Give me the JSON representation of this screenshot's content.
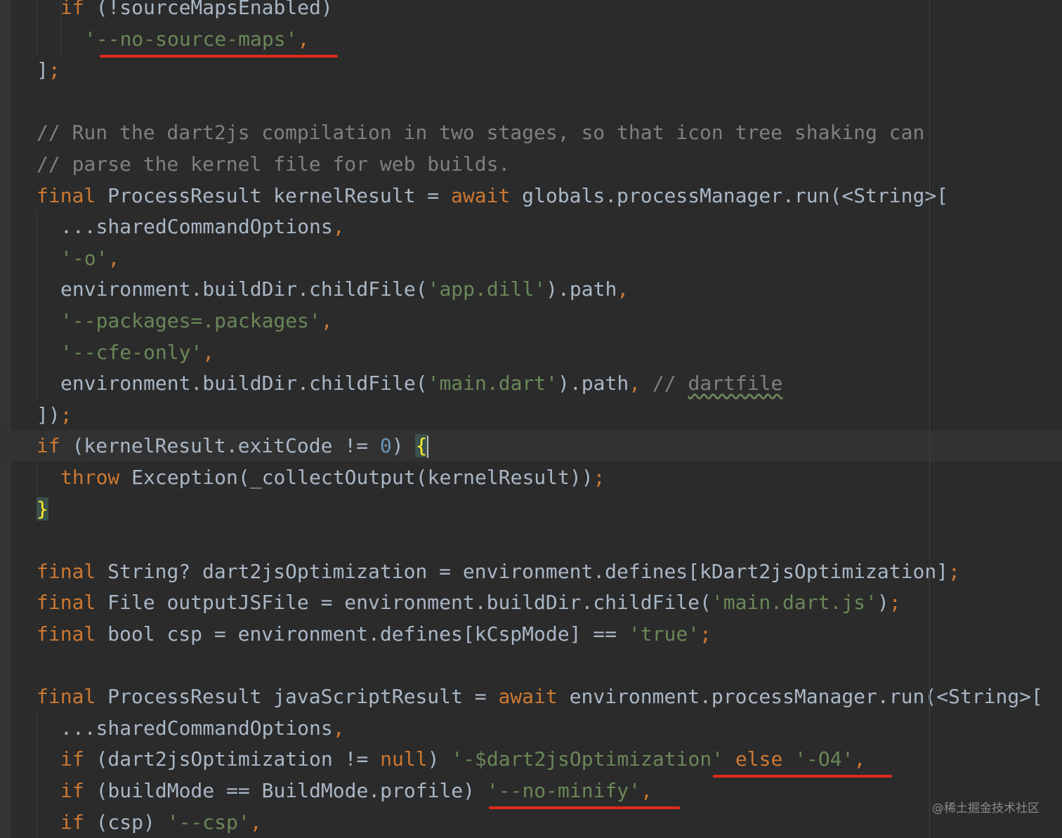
{
  "editor": {
    "lines": [
      {
        "indent": 1,
        "tokens": [
          {
            "c": "k",
            "t": "if"
          },
          {
            "c": "t",
            "t": " (!sourceMapsEnabled)"
          }
        ]
      },
      {
        "indent": 2,
        "tokens": [
          {
            "c": "s",
            "t": "'--no-source-maps'"
          },
          {
            "c": "p",
            "t": ","
          }
        ]
      },
      {
        "indent": 0,
        "tokens": [
          {
            "c": "t",
            "t": "]"
          },
          {
            "c": "p",
            "t": ";"
          }
        ]
      },
      {
        "indent": 0,
        "tokens": []
      },
      {
        "indent": 0,
        "tokens": [
          {
            "c": "c",
            "t": "// Run the dart2js compilation in two stages, so that icon tree shaking can"
          }
        ]
      },
      {
        "indent": 0,
        "tokens": [
          {
            "c": "c",
            "t": "// parse the kernel file for web builds."
          }
        ]
      },
      {
        "indent": 0,
        "tokens": [
          {
            "c": "k",
            "t": "final"
          },
          {
            "c": "t",
            "t": " ProcessResult kernelResult = "
          },
          {
            "c": "k",
            "t": "await"
          },
          {
            "c": "t",
            "t": " globals.processManager.run(<String>["
          }
        ]
      },
      {
        "indent": 1,
        "tokens": [
          {
            "c": "t",
            "t": "...sharedCommandOptions"
          },
          {
            "c": "p",
            "t": ","
          }
        ]
      },
      {
        "indent": 1,
        "tokens": [
          {
            "c": "s",
            "t": "'-o'"
          },
          {
            "c": "p",
            "t": ","
          }
        ]
      },
      {
        "indent": 1,
        "tokens": [
          {
            "c": "t",
            "t": "environment.buildDir.childFile("
          },
          {
            "c": "s",
            "t": "'app.dill'"
          },
          {
            "c": "t",
            "t": ").path"
          },
          {
            "c": "p",
            "t": ","
          }
        ]
      },
      {
        "indent": 1,
        "tokens": [
          {
            "c": "s",
            "t": "'--packages=.packages'"
          },
          {
            "c": "p",
            "t": ","
          }
        ]
      },
      {
        "indent": 1,
        "tokens": [
          {
            "c": "s",
            "t": "'--cfe-only'"
          },
          {
            "c": "p",
            "t": ","
          }
        ]
      },
      {
        "indent": 1,
        "tokens": [
          {
            "c": "t",
            "t": "environment.buildDir.childFile("
          },
          {
            "c": "s",
            "t": "'main.dart'"
          },
          {
            "c": "t",
            "t": ").path"
          },
          {
            "c": "p",
            "t": ","
          },
          {
            "c": "c",
            "t": " // "
          },
          {
            "c": "c warn",
            "t": "dartfile"
          }
        ]
      },
      {
        "indent": 0,
        "tokens": [
          {
            "c": "t",
            "t": "])"
          },
          {
            "c": "p",
            "t": ";"
          }
        ]
      },
      {
        "indent": 0,
        "current": true,
        "tokens": [
          {
            "c": "k",
            "t": "if"
          },
          {
            "c": "t",
            "t": " (kernelResult.exitCode != "
          },
          {
            "c": "n",
            "t": "0"
          },
          {
            "c": "t",
            "t": ") "
          },
          {
            "c": "brace-hl",
            "t": "{"
          },
          {
            "c": "caret",
            "t": ""
          }
        ]
      },
      {
        "indent": 1,
        "tokens": [
          {
            "c": "k",
            "t": "throw"
          },
          {
            "c": "t",
            "t": " Exception(_collectOutput(kernelResult))"
          },
          {
            "c": "p",
            "t": ";"
          }
        ]
      },
      {
        "indent": 0,
        "tokens": [
          {
            "c": "brace-hl",
            "t": "}"
          }
        ]
      },
      {
        "indent": 0,
        "tokens": []
      },
      {
        "indent": 0,
        "tokens": [
          {
            "c": "k",
            "t": "final"
          },
          {
            "c": "t",
            "t": " String? dart2jsOptimization = environment.defines[kDart2jsOptimization]"
          },
          {
            "c": "p",
            "t": ";"
          }
        ]
      },
      {
        "indent": 0,
        "tokens": [
          {
            "c": "k",
            "t": "final"
          },
          {
            "c": "t",
            "t": " File outputJSFile = environment.buildDir.childFile("
          },
          {
            "c": "s",
            "t": "'main.dart.js'"
          },
          {
            "c": "t",
            "t": ")"
          },
          {
            "c": "p",
            "t": ";"
          }
        ]
      },
      {
        "indent": 0,
        "tokens": [
          {
            "c": "k",
            "t": "final"
          },
          {
            "c": "t",
            "t": " bool csp = environment.defines[kCspMode] == "
          },
          {
            "c": "s",
            "t": "'true'"
          },
          {
            "c": "p",
            "t": ";"
          }
        ]
      },
      {
        "indent": 0,
        "tokens": []
      },
      {
        "indent": 0,
        "tokens": [
          {
            "c": "k",
            "t": "final"
          },
          {
            "c": "t",
            "t": " ProcessResult javaScriptResult = "
          },
          {
            "c": "k",
            "t": "await"
          },
          {
            "c": "t",
            "t": " environment.processManager.run(<String>["
          }
        ]
      },
      {
        "indent": 1,
        "tokens": [
          {
            "c": "t",
            "t": "...sharedCommandOptions"
          },
          {
            "c": "p",
            "t": ","
          }
        ]
      },
      {
        "indent": 1,
        "tokens": [
          {
            "c": "k",
            "t": "if"
          },
          {
            "c": "t",
            "t": " (dart2jsOptimization != "
          },
          {
            "c": "k",
            "t": "null"
          },
          {
            "c": "t",
            "t": ") "
          },
          {
            "c": "s",
            "t": "'-$dart2jsOptimization'"
          },
          {
            "c": "t",
            "t": " "
          },
          {
            "c": "k",
            "t": "else"
          },
          {
            "c": "t",
            "t": " "
          },
          {
            "c": "s",
            "t": "'-O4'"
          },
          {
            "c": "p",
            "t": ","
          }
        ]
      },
      {
        "indent": 1,
        "tokens": [
          {
            "c": "k",
            "t": "if"
          },
          {
            "c": "t",
            "t": " (buildMode == BuildMode.profile) "
          },
          {
            "c": "s",
            "t": "'--no-minify'"
          },
          {
            "c": "p",
            "t": ","
          }
        ]
      },
      {
        "indent": 1,
        "tokens": [
          {
            "c": "k",
            "t": "if"
          },
          {
            "c": "t",
            "t": " (csp) "
          },
          {
            "c": "s",
            "t": "'--csp'"
          },
          {
            "c": "p",
            "t": ","
          }
        ]
      }
    ],
    "annotations": [
      {
        "line": 1,
        "from_char": 2,
        "to_char": 21
      },
      {
        "line": 24,
        "from_char": 56,
        "to_char": 70
      },
      {
        "line": 25,
        "from_char": 37,
        "to_char": 52
      }
    ]
  },
  "watermark": "@稀土掘金技术社区",
  "colors": {
    "background": "#2b2b2b",
    "keyword": "#cc7832",
    "string": "#6a8759",
    "comment": "#808080",
    "number": "#6897bb",
    "identifier": "#a9b7c6",
    "annotation_underline": "#e02a1c"
  }
}
